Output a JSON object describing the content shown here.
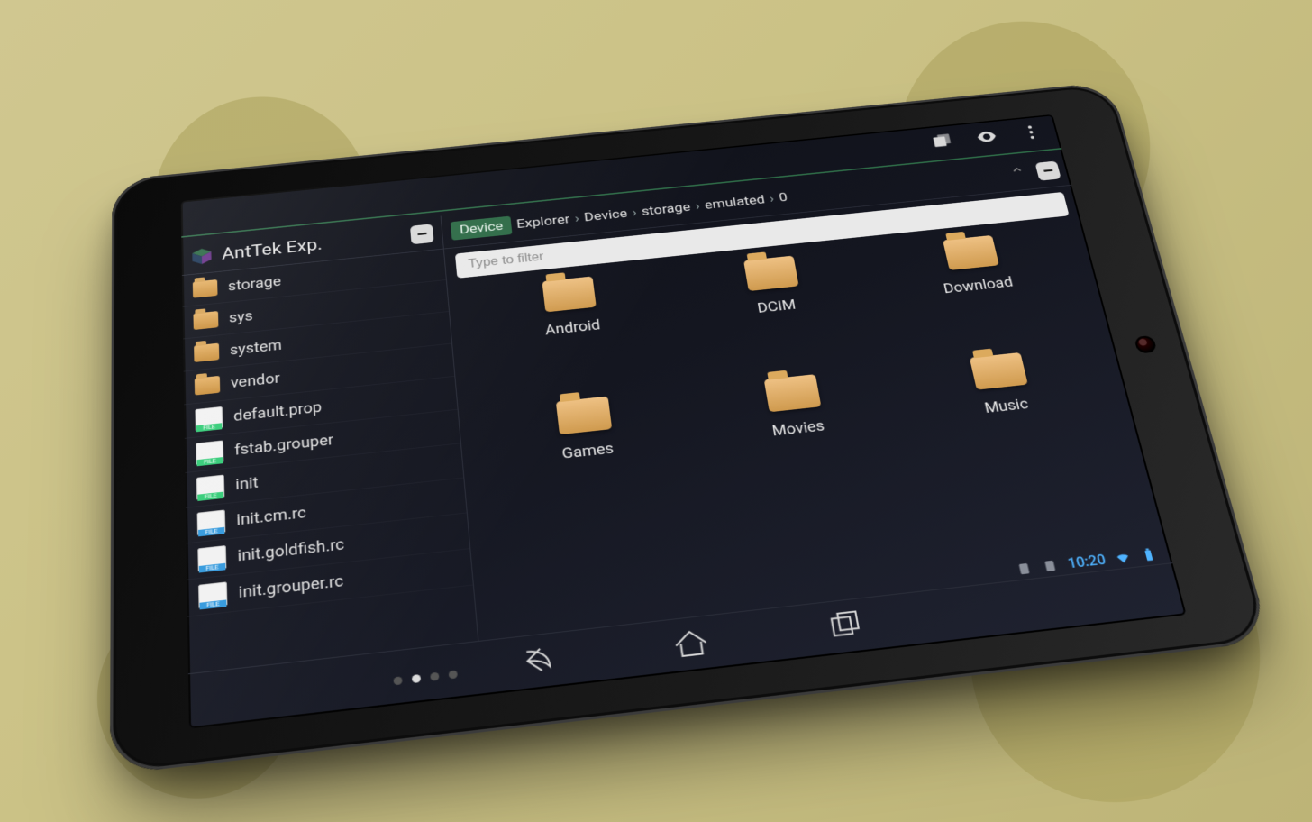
{
  "app": {
    "title": "AntTek Exp."
  },
  "actionbar": {
    "icons": [
      "multiwindow-icon",
      "visibility-icon",
      "overflow-icon"
    ]
  },
  "left_pane": {
    "collapse_label": "–",
    "items": [
      {
        "type": "folder",
        "name": "storage"
      },
      {
        "type": "folder",
        "name": "sys"
      },
      {
        "type": "folder",
        "name": "system"
      },
      {
        "type": "folder",
        "name": "vendor"
      },
      {
        "type": "file",
        "name": "default.prop"
      },
      {
        "type": "file",
        "name": "fstab.grouper"
      },
      {
        "type": "file",
        "name": "init"
      },
      {
        "type": "rc",
        "name": "init.cm.rc"
      },
      {
        "type": "rc",
        "name": "init.goldfish.rc"
      },
      {
        "type": "rc",
        "name": "init.grouper.rc"
      }
    ]
  },
  "right_pane": {
    "breadcrumb_root": "Device",
    "breadcrumbs": [
      "Explorer",
      "Device",
      "storage",
      "emulated",
      "0"
    ],
    "collapse_label": "–",
    "filter_placeholder": "Type to filter",
    "filter_value": "",
    "grid": [
      "Android",
      "DCIM",
      "Download",
      "Games",
      "Movies",
      "Music"
    ]
  },
  "pager": {
    "count": 4,
    "active_index": 1
  },
  "status": {
    "time": "10:20"
  }
}
